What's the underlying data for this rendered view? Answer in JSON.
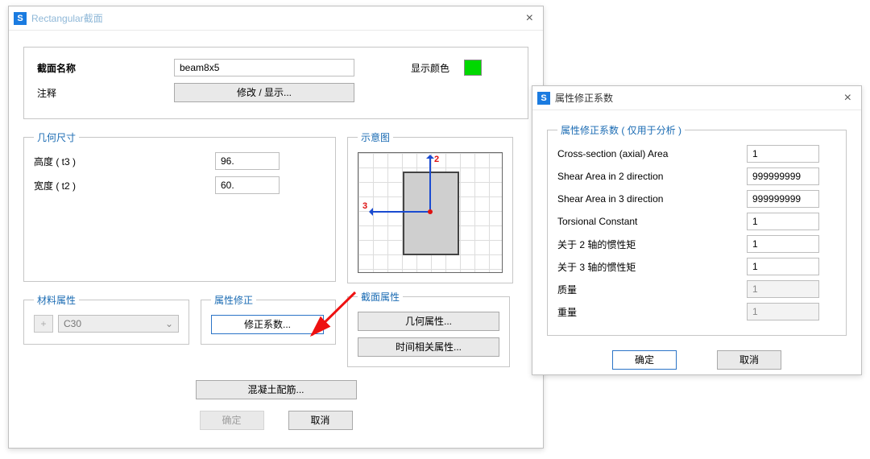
{
  "mainWindow": {
    "title": "Rectangular截面",
    "sectionNameLabel": "截面名称",
    "sectionName": "beam8x5",
    "annotationLabel": "注释",
    "modifyShowBtn": "修改 / 显示...",
    "displayColorLabel": "显示颜色",
    "colorSwatch": "#00d800",
    "geomGroup": "几何尺寸",
    "heightLabel": "高度 ( t3 )",
    "heightValue": "96.",
    "widthLabel": "宽度 ( t2 )",
    "widthValue": "60.",
    "previewGroup": "示意图",
    "axis2": "2",
    "axis3": "3",
    "materialGroup": "材料属性",
    "plus": "+",
    "material": "C30",
    "modifierGroup": "属性修正",
    "modifierBtn": "修正系数...",
    "sectPropGroup": "截面属性",
    "geomPropBtn": "几何属性...",
    "timeDepBtn": "时间相关属性...",
    "concreteRebarBtn": "混凝土配筋...",
    "ok": "确定",
    "cancel": "取消"
  },
  "dialog": {
    "title": "属性修正系数",
    "group": "属性修正系数 ( 仅用于分析 )",
    "rows": [
      {
        "label": "Cross-section (axial) Area",
        "value": "1"
      },
      {
        "label": "Shear Area in 2 direction",
        "value": "999999999"
      },
      {
        "label": "Shear Area in 3 direction",
        "value": "999999999"
      },
      {
        "label": "Torsional Constant",
        "value": "1"
      },
      {
        "label": "关于 2 轴的惯性矩",
        "value": "1"
      },
      {
        "label": "关于 3 轴的惯性矩",
        "value": "1"
      },
      {
        "label": "质量",
        "value": "1",
        "readonly": true
      },
      {
        "label": "重量",
        "value": "1",
        "readonly": true
      }
    ],
    "ok": "确定",
    "cancel": "取消"
  }
}
